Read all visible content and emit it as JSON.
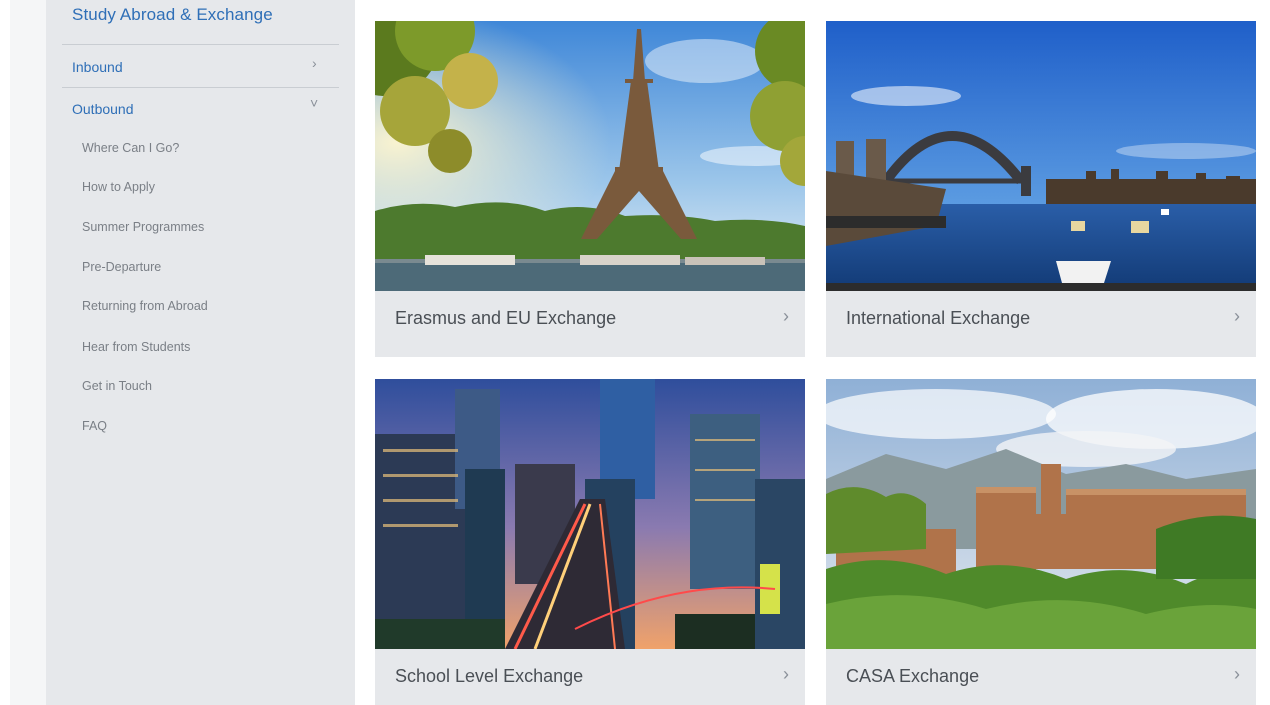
{
  "sidebar": {
    "title": "Study Abroad & Exchange",
    "inbound_label": "Inbound",
    "outbound_label": "Outbound",
    "outbound_items": [
      "Where Can I Go?",
      "How to Apply",
      "Summer Programmes",
      "Pre-Departure",
      "Returning from Abroad",
      "Hear from Students",
      "Get in Touch",
      "FAQ"
    ]
  },
  "cards": [
    {
      "label": "Erasmus and EU Exchange"
    },
    {
      "label": "International Exchange"
    },
    {
      "label": "School Level Exchange"
    },
    {
      "label": "CASA Exchange"
    }
  ],
  "icons": {
    "chevron_right": "›",
    "chevron_down": "˅"
  },
  "colors": {
    "link_blue": "#2f6fb7",
    "panel_grey": "#e6e8eb"
  }
}
